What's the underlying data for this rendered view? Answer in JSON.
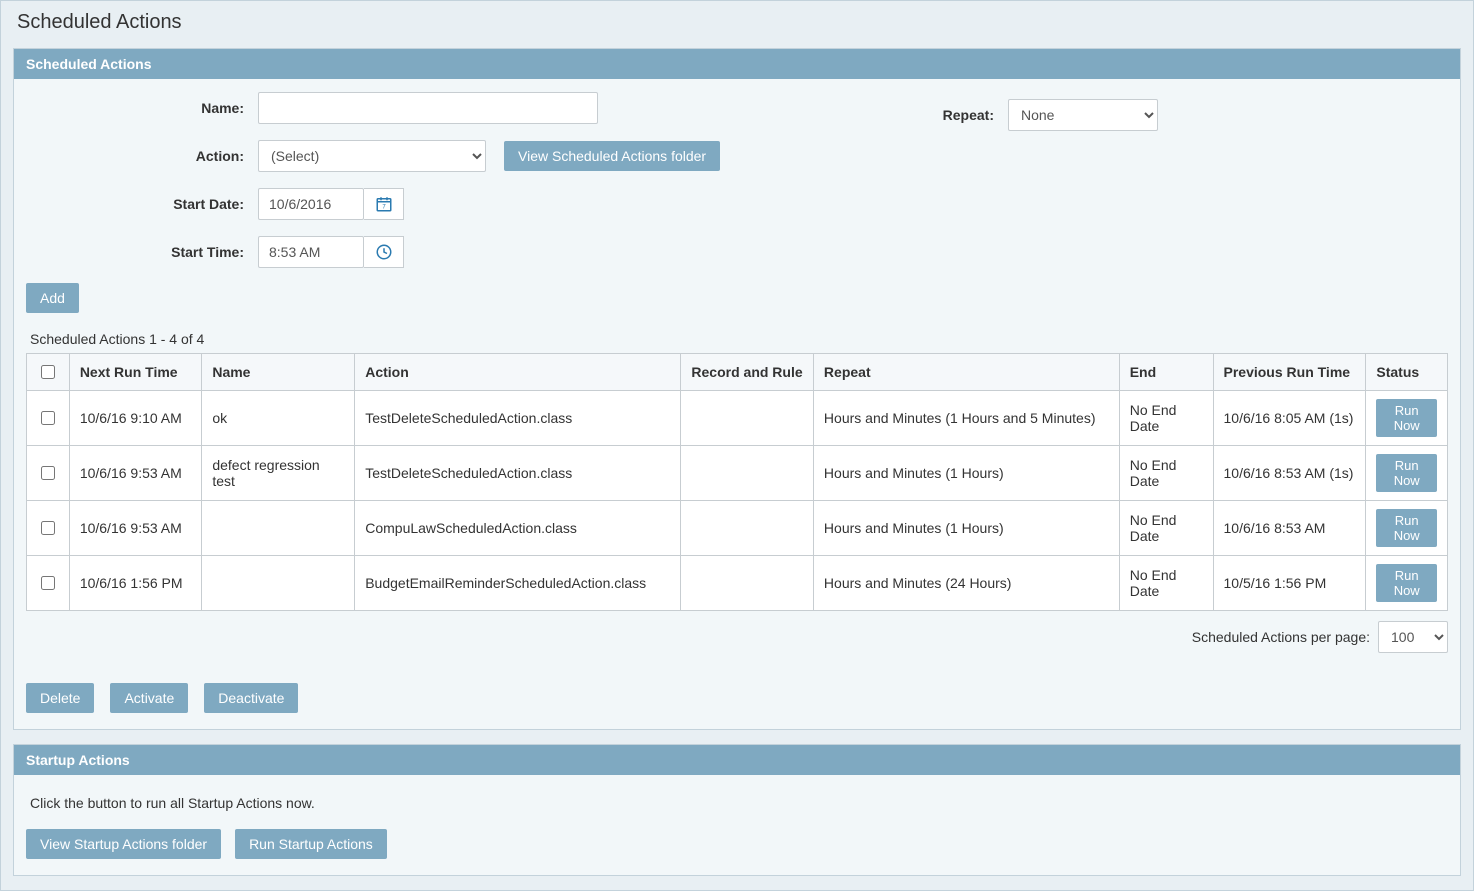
{
  "page": {
    "title": "Scheduled Actions"
  },
  "panel1": {
    "title": "Scheduled Actions",
    "form": {
      "name_label": "Name:",
      "name_value": "",
      "action_label": "Action:",
      "action_value": "(Select)",
      "view_folder_btn": "View Scheduled Actions folder",
      "start_date_label": "Start Date:",
      "start_date_value": "10/6/2016",
      "start_time_label": "Start Time:",
      "start_time_value": "8:53 AM",
      "repeat_label": "Repeat:",
      "repeat_value": "None",
      "add_btn": "Add"
    },
    "table": {
      "caption": "Scheduled Actions 1 - 4 of 4",
      "headers": {
        "next": "Next Run Time",
        "name": "Name",
        "action": "Action",
        "record": "Record and Rule",
        "repeat": "Repeat",
        "end": "End",
        "prev": "Previous Run Time",
        "status": "Status"
      },
      "rows": [
        {
          "next": "10/6/16 9:10 AM",
          "name": "ok",
          "action": "TestDeleteScheduledAction.class",
          "record": "",
          "repeat": "Hours and Minutes (1 Hours and 5 Minutes)",
          "end": "No End Date",
          "prev": "10/6/16 8:05 AM (1s)",
          "run": "Run Now"
        },
        {
          "next": "10/6/16 9:53 AM",
          "name": "defect regression test",
          "action": "TestDeleteScheduledAction.class",
          "record": "",
          "repeat": "Hours and Minutes (1 Hours)",
          "end": "No End Date",
          "prev": "10/6/16 8:53 AM (1s)",
          "run": "Run Now"
        },
        {
          "next": "10/6/16 9:53 AM",
          "name": "",
          "action": "CompuLawScheduledAction.class",
          "record": "",
          "repeat": "Hours and Minutes (1 Hours)",
          "end": "No End Date",
          "prev": "10/6/16 8:53 AM",
          "run": "Run Now"
        },
        {
          "next": "10/6/16 1:56 PM",
          "name": "",
          "action": "BudgetEmailReminderScheduledAction.class",
          "record": "",
          "repeat": "Hours and Minutes (24 Hours)",
          "end": "No End Date",
          "prev": "10/5/16 1:56 PM",
          "run": "Run Now"
        }
      ],
      "pager_label": "Scheduled Actions per page:",
      "pager_value": "100"
    },
    "buttons": {
      "delete": "Delete",
      "activate": "Activate",
      "deactivate": "Deactivate"
    }
  },
  "panel2": {
    "title": "Startup Actions",
    "text": "Click the button to run all Startup Actions now.",
    "buttons": {
      "view_folder": "View Startup Actions folder",
      "run": "Run Startup Actions"
    }
  }
}
